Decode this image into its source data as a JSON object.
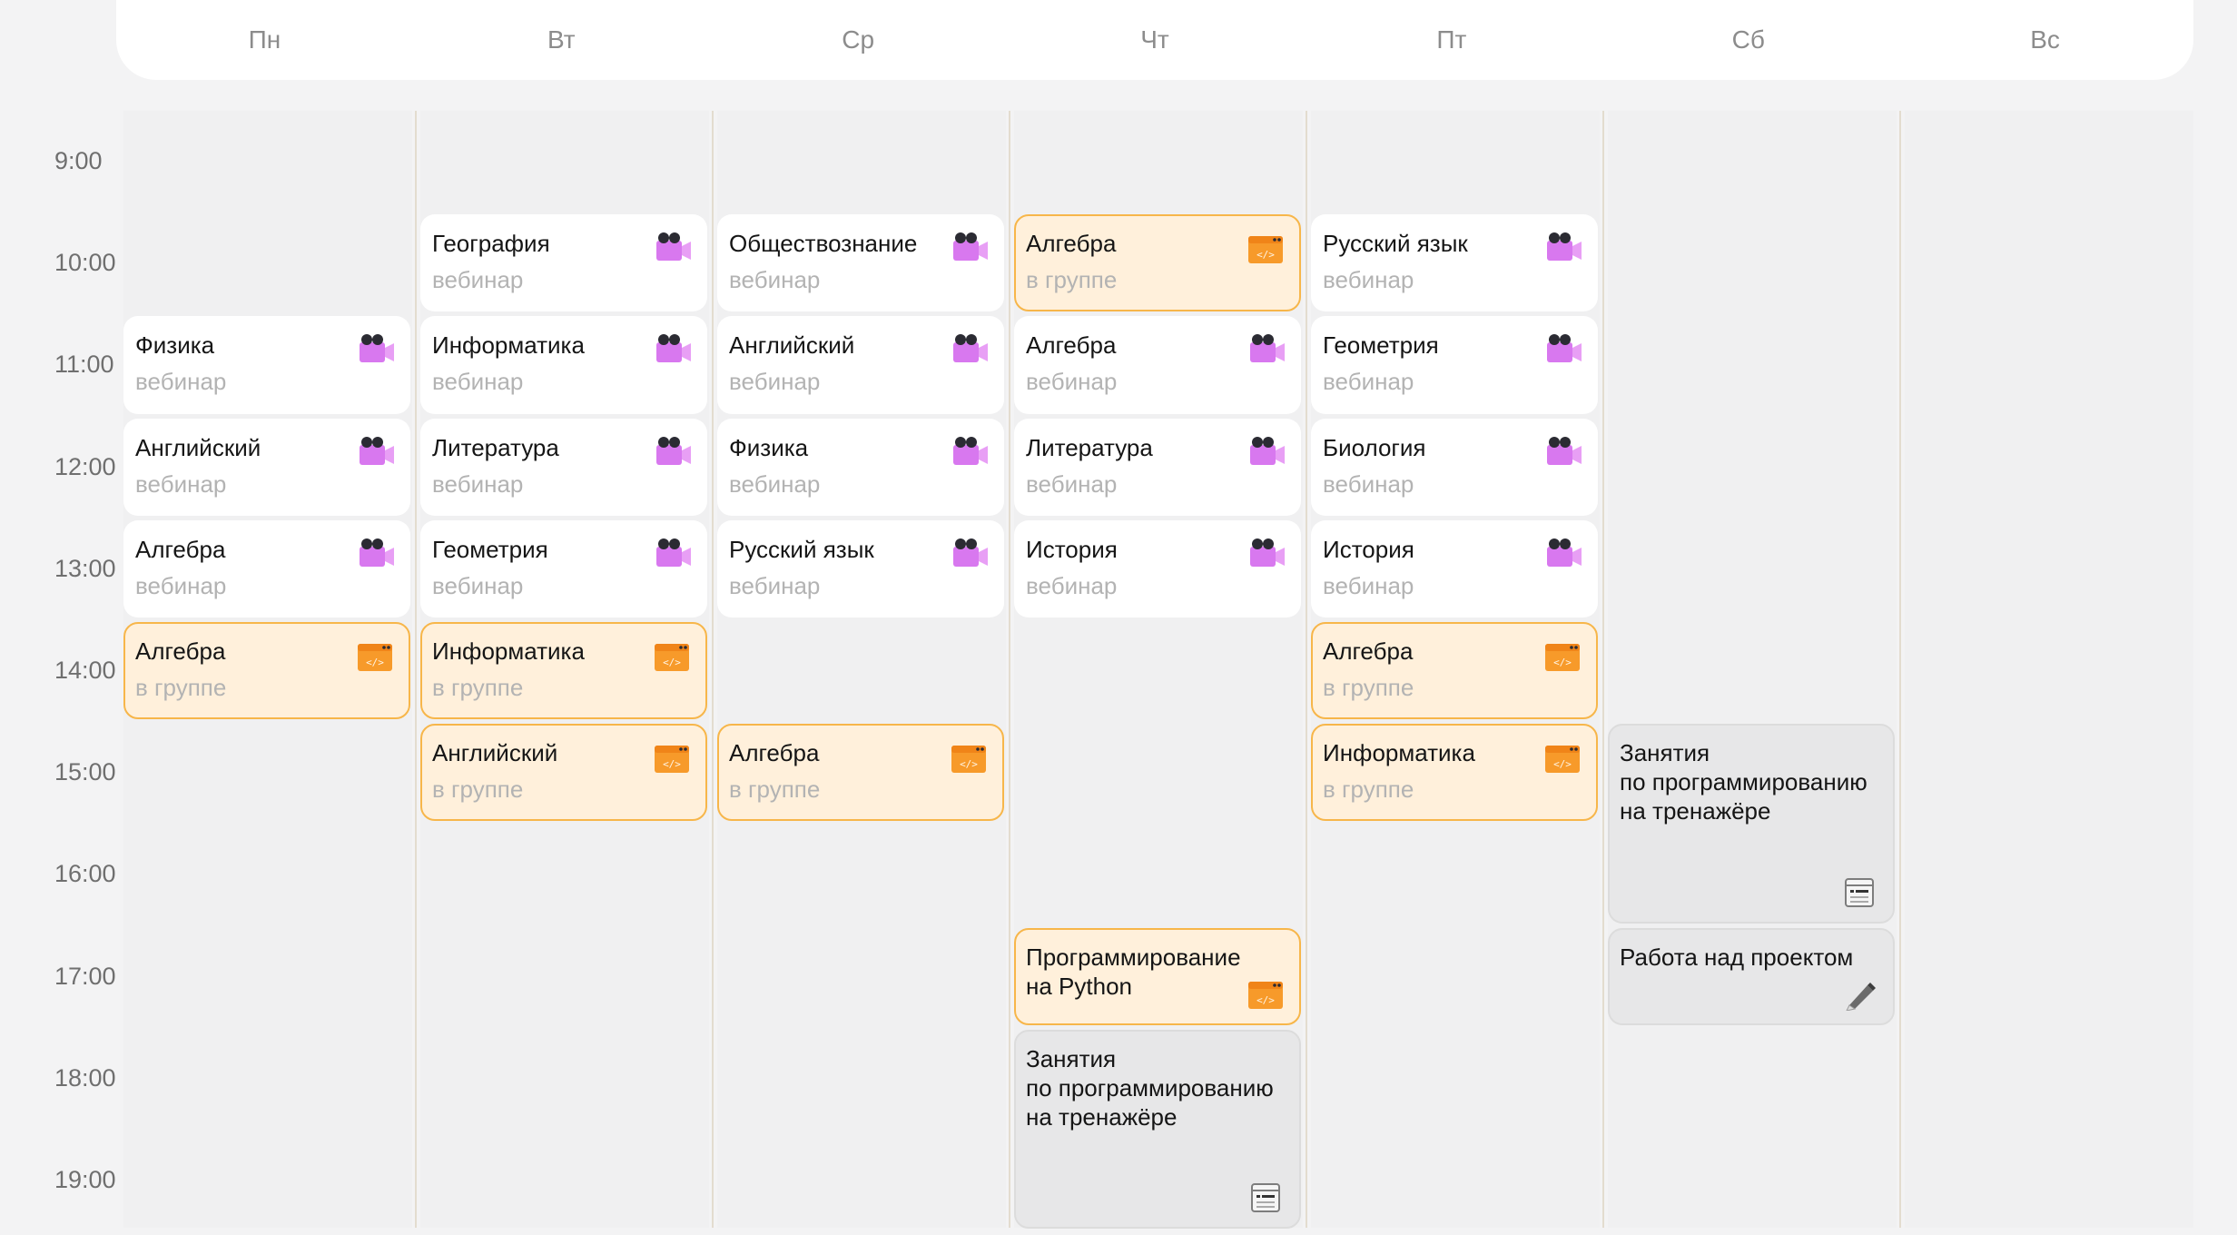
{
  "days": [
    "Пн",
    "Вт",
    "Ср",
    "Чт",
    "Пт",
    "Сб",
    "Вс"
  ],
  "times": [
    "9:00",
    "10:00",
    "11:00",
    "12:00",
    "13:00",
    "14:00",
    "15:00",
    "16:00",
    "17:00",
    "18:00",
    "19:00"
  ],
  "colors": {
    "background": "#f3f3f4",
    "webinar_card": "#ffffff",
    "group_card": "#fff0db",
    "group_border": "#f7b64a",
    "trainer_card": "#e7e7e8",
    "camera_icon": "#d878ef",
    "code_icon": "#f79a2a"
  },
  "events": [
    {
      "day": 0,
      "start": "11:00",
      "end": "12:00",
      "title": "Физика",
      "subtitle": "вебинар",
      "kind": "webinar",
      "icon": "video-camera-icon"
    },
    {
      "day": 0,
      "start": "12:00",
      "end": "13:00",
      "title": "Английский",
      "subtitle": "вебинар",
      "kind": "webinar",
      "icon": "video-camera-icon"
    },
    {
      "day": 0,
      "start": "13:00",
      "end": "14:00",
      "title": "Алгебра",
      "subtitle": "вебинар",
      "kind": "webinar",
      "icon": "video-camera-icon"
    },
    {
      "day": 0,
      "start": "14:00",
      "end": "15:00",
      "title": "Алгебра",
      "subtitle": "в группе",
      "kind": "group",
      "icon": "code-window-icon"
    },
    {
      "day": 1,
      "start": "10:00",
      "end": "11:00",
      "title": "География",
      "subtitle": "вебинар",
      "kind": "webinar",
      "icon": "video-camera-icon"
    },
    {
      "day": 1,
      "start": "11:00",
      "end": "12:00",
      "title": "Информатика",
      "subtitle": "вебинар",
      "kind": "webinar",
      "icon": "video-camera-icon"
    },
    {
      "day": 1,
      "start": "12:00",
      "end": "13:00",
      "title": "Литература",
      "subtitle": "вебинар",
      "kind": "webinar",
      "icon": "video-camera-icon"
    },
    {
      "day": 1,
      "start": "13:00",
      "end": "14:00",
      "title": "Геометрия",
      "subtitle": "вебинар",
      "kind": "webinar",
      "icon": "video-camera-icon"
    },
    {
      "day": 1,
      "start": "14:00",
      "end": "15:00",
      "title": "Информатика",
      "subtitle": "в группе",
      "kind": "group",
      "icon": "code-window-icon"
    },
    {
      "day": 1,
      "start": "15:00",
      "end": "16:00",
      "title": "Английский",
      "subtitle": "в группе",
      "kind": "group",
      "icon": "code-window-icon"
    },
    {
      "day": 2,
      "start": "10:00",
      "end": "11:00",
      "title": "Обществознание",
      "subtitle": "вебинар",
      "kind": "webinar",
      "icon": "video-camera-icon"
    },
    {
      "day": 2,
      "start": "11:00",
      "end": "12:00",
      "title": "Английский",
      "subtitle": "вебинар",
      "kind": "webinar",
      "icon": "video-camera-icon"
    },
    {
      "day": 2,
      "start": "12:00",
      "end": "13:00",
      "title": "Физика",
      "subtitle": "вебинар",
      "kind": "webinar",
      "icon": "video-camera-icon"
    },
    {
      "day": 2,
      "start": "13:00",
      "end": "14:00",
      "title": "Русский язык",
      "subtitle": "вебинар",
      "kind": "webinar",
      "icon": "video-camera-icon"
    },
    {
      "day": 2,
      "start": "15:00",
      "end": "16:00",
      "title": "Алгебра",
      "subtitle": "в группе",
      "kind": "group",
      "icon": "code-window-icon"
    },
    {
      "day": 3,
      "start": "10:00",
      "end": "11:00",
      "title": "Алгебра",
      "subtitle": "в группе",
      "kind": "group",
      "icon": "code-window-icon"
    },
    {
      "day": 3,
      "start": "11:00",
      "end": "12:00",
      "title": "Алгебра",
      "subtitle": "вебинар",
      "kind": "webinar",
      "icon": "video-camera-icon"
    },
    {
      "day": 3,
      "start": "12:00",
      "end": "13:00",
      "title": "Литература",
      "subtitle": "вебинар",
      "kind": "webinar",
      "icon": "video-camera-icon"
    },
    {
      "day": 3,
      "start": "13:00",
      "end": "14:00",
      "title": "История",
      "subtitle": "вебинар",
      "kind": "webinar",
      "icon": "video-camera-icon"
    },
    {
      "day": 3,
      "start": "17:00",
      "end": "18:00",
      "title": "Программирование\nна Python",
      "subtitle": "",
      "kind": "group",
      "icon": "code-window-icon"
    },
    {
      "day": 3,
      "start": "18:00",
      "end": "20:00",
      "title": "Занятия\nпо программированию\nна тренажёре",
      "subtitle": "",
      "kind": "trainer",
      "icon": "terminal-window-icon"
    },
    {
      "day": 4,
      "start": "10:00",
      "end": "11:00",
      "title": "Русский язык",
      "subtitle": "вебинар",
      "kind": "webinar",
      "icon": "video-camera-icon"
    },
    {
      "day": 4,
      "start": "11:00",
      "end": "12:00",
      "title": "Геометрия",
      "subtitle": "вебинар",
      "kind": "webinar",
      "icon": "video-camera-icon"
    },
    {
      "day": 4,
      "start": "12:00",
      "end": "13:00",
      "title": "Биология",
      "subtitle": "вебинар",
      "kind": "webinar",
      "icon": "video-camera-icon"
    },
    {
      "day": 4,
      "start": "13:00",
      "end": "14:00",
      "title": "История",
      "subtitle": "вебинар",
      "kind": "webinar",
      "icon": "video-camera-icon"
    },
    {
      "day": 4,
      "start": "14:00",
      "end": "15:00",
      "title": "Алгебра",
      "subtitle": "в группе",
      "kind": "group",
      "icon": "code-window-icon"
    },
    {
      "day": 4,
      "start": "15:00",
      "end": "16:00",
      "title": "Информатика",
      "subtitle": "в группе",
      "kind": "group",
      "icon": "code-window-icon"
    },
    {
      "day": 5,
      "start": "15:00",
      "end": "17:00",
      "title": "Занятия\nпо программированию\nна тренажёре",
      "subtitle": "",
      "kind": "trainer",
      "icon": "terminal-window-icon"
    },
    {
      "day": 5,
      "start": "17:00",
      "end": "18:00",
      "title": "Работа над проектом",
      "subtitle": "",
      "kind": "trainer",
      "icon": "pencil-icon"
    }
  ]
}
